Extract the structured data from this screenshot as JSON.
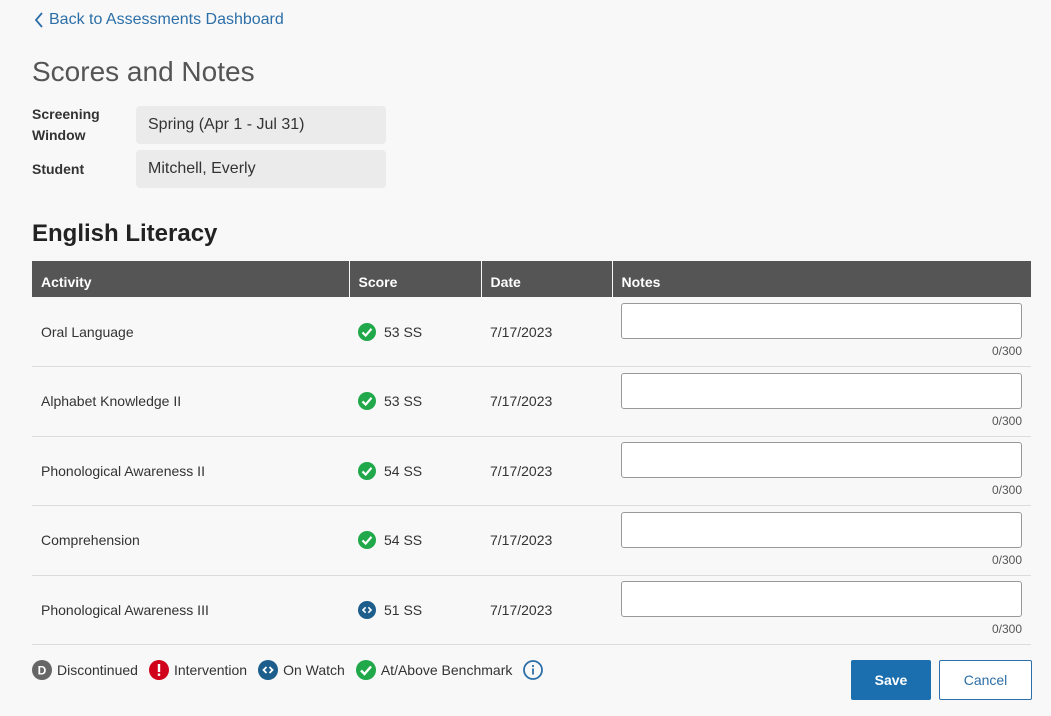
{
  "nav": {
    "back_label": "Back to Assessments Dashboard"
  },
  "page": {
    "title": "Scores and Notes"
  },
  "fields": {
    "screening_label_1": "Screening",
    "screening_label_2": "Window",
    "screening_value": "Spring (Apr 1 - Jul 31)",
    "student_label": "Student",
    "student_value": "Mitchell, Everly"
  },
  "section": {
    "title": "English Literacy"
  },
  "table": {
    "headers": {
      "activity": "Activity",
      "score": "Score",
      "date": "Date",
      "notes": "Notes"
    },
    "rows": [
      {
        "activity": "Oral Language",
        "score": "53 SS",
        "status": "at-above-benchmark",
        "date": "7/17/2023",
        "notes": "",
        "counter": "0/300"
      },
      {
        "activity": "Alphabet Knowledge II",
        "score": "53 SS",
        "status": "at-above-benchmark",
        "date": "7/17/2023",
        "notes": "",
        "counter": "0/300"
      },
      {
        "activity": "Phonological Awareness II",
        "score": "54 SS",
        "status": "at-above-benchmark",
        "date": "7/17/2023",
        "notes": "",
        "counter": "0/300"
      },
      {
        "activity": "Comprehension",
        "score": "54 SS",
        "status": "at-above-benchmark",
        "date": "7/17/2023",
        "notes": "",
        "counter": "0/300"
      },
      {
        "activity": "Phonological Awareness III",
        "score": "51 SS",
        "status": "on-watch",
        "date": "7/17/2023",
        "notes": "",
        "counter": "0/300"
      }
    ]
  },
  "legend": {
    "discontinued_glyph": "D",
    "discontinued": "Discontinued",
    "intervention": "Intervention",
    "on_watch": "On Watch",
    "at_above": "At/Above Benchmark"
  },
  "actions": {
    "save": "Save",
    "cancel": "Cancel"
  },
  "colors": {
    "accent": "#1b6fae",
    "link": "#2c6fa8",
    "header_bg": "#555555",
    "benchmark_green": "#21a84a",
    "intervention_red": "#d0021b",
    "on_watch_blue": "#1c5d8c",
    "discontinued_gray": "#666666"
  }
}
